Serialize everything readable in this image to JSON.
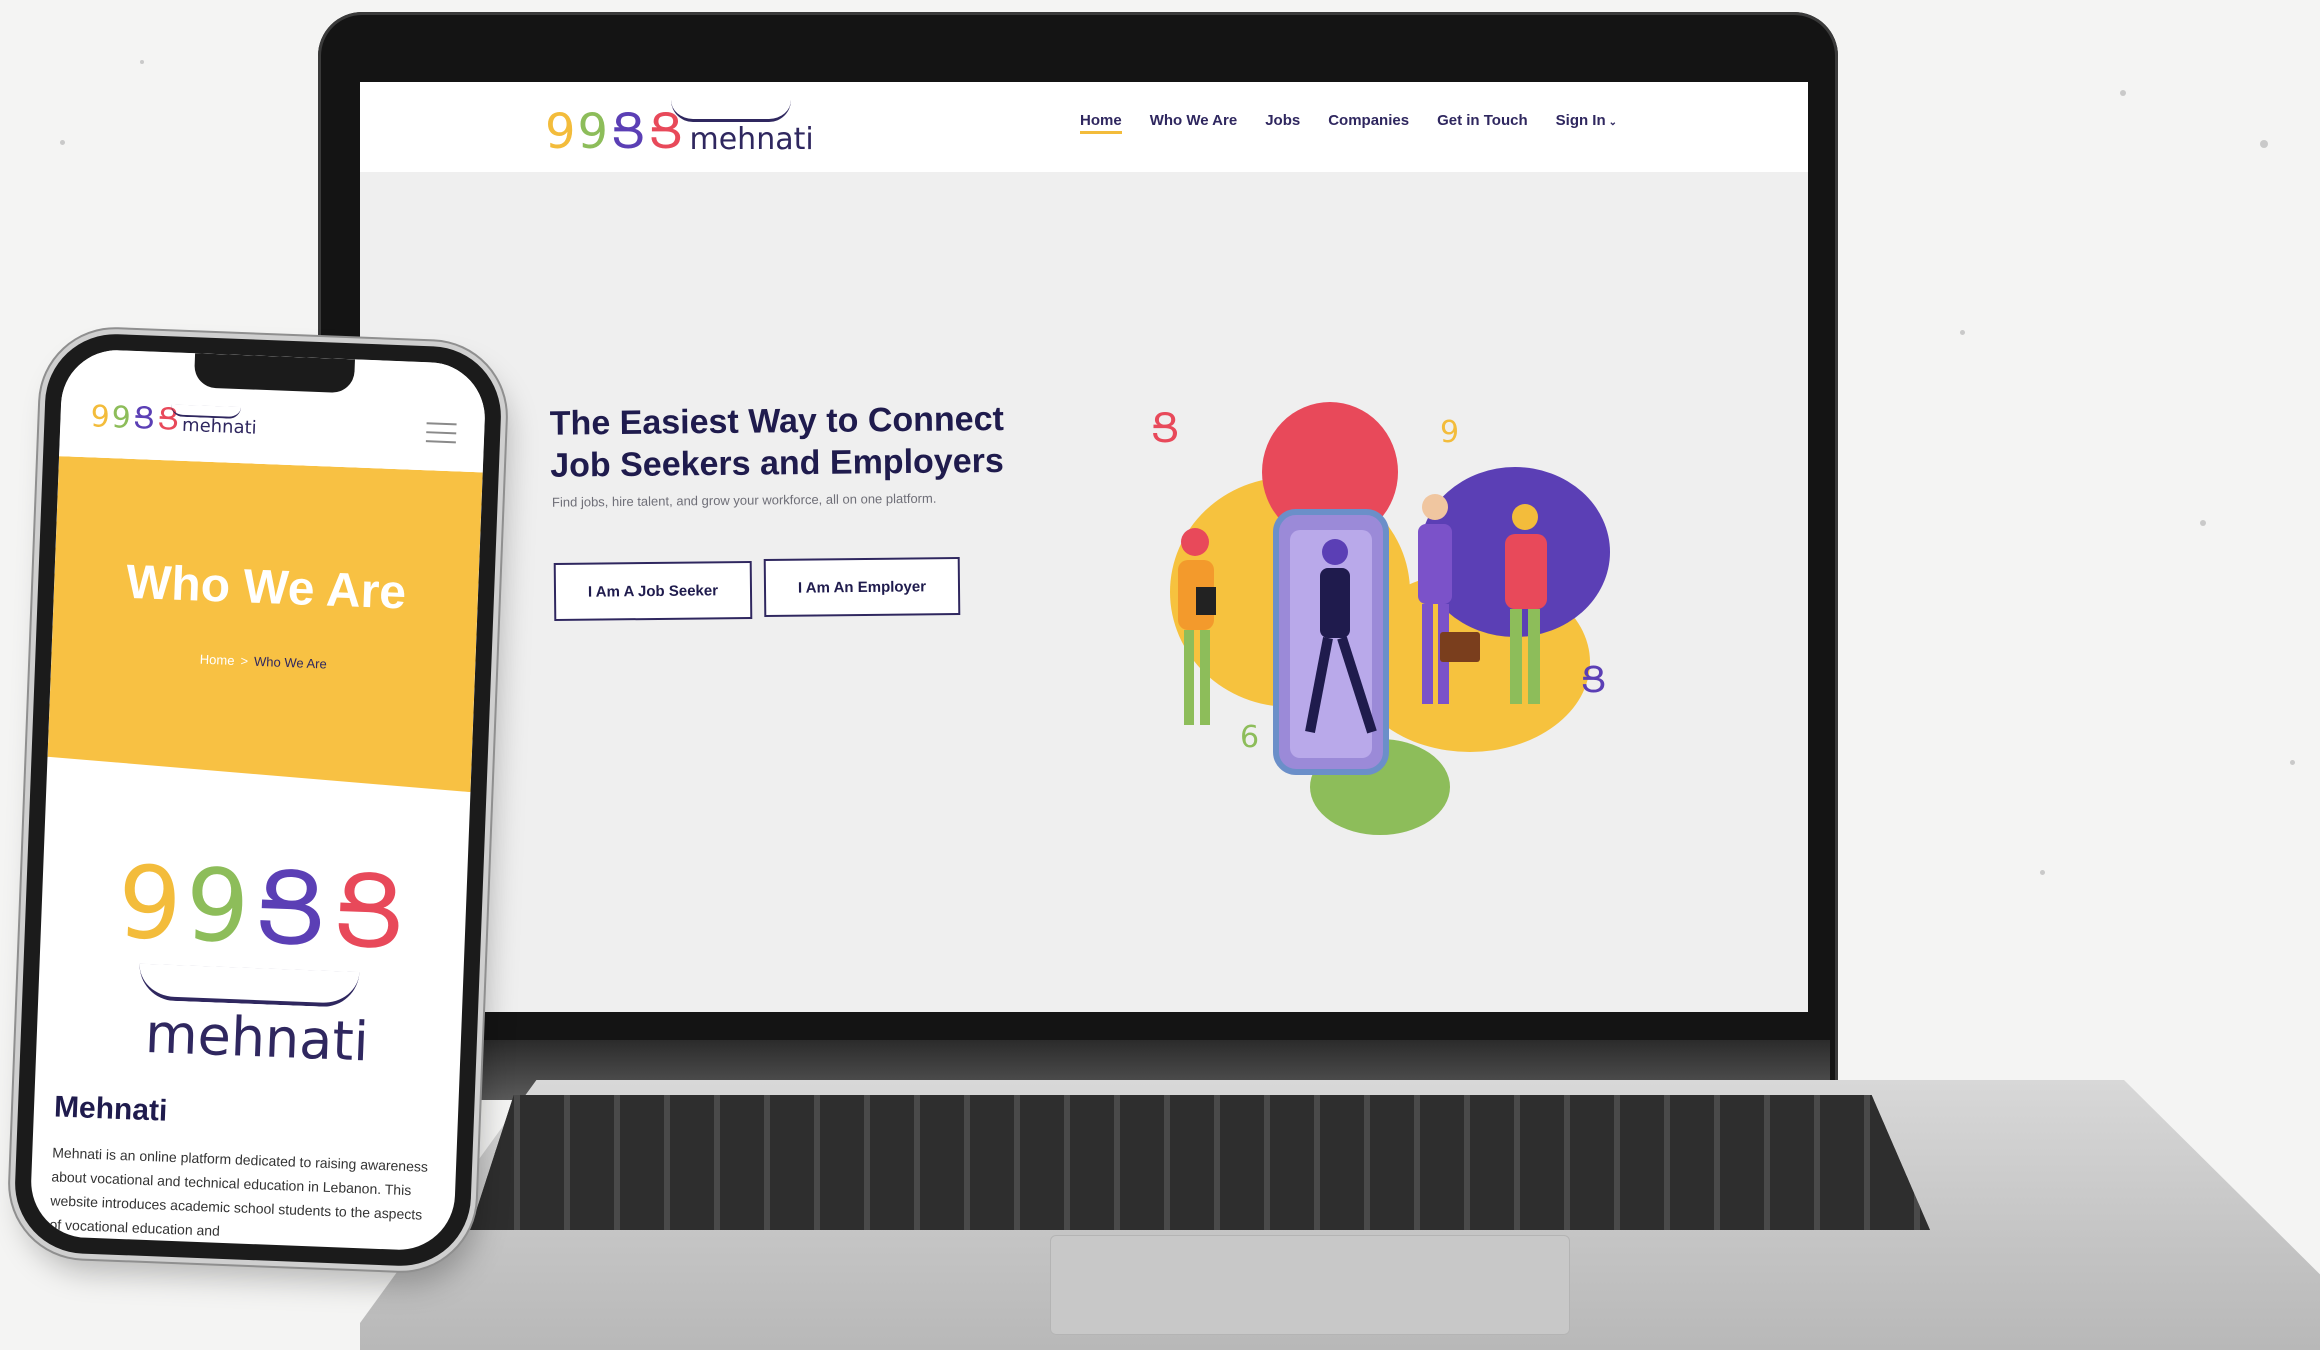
{
  "desktop": {
    "logo": {
      "glyphs": [
        "9",
        "9",
        "Ց",
        "Ց"
      ],
      "wordmark": "mehnati"
    },
    "nav": {
      "home": "Home",
      "who_we_are": "Who We Are",
      "jobs": "Jobs",
      "companies": "Companies",
      "get_in_touch": "Get in Touch",
      "sign_in": "Sign In"
    },
    "hero": {
      "title_line1": "The Easiest Way to Connect",
      "title_line2": "Job Seekers and Employers",
      "subtitle": "Find jobs, hire talent, and grow your workforce, all on one platform.",
      "btn_seeker": "I Am A Job Seeker",
      "btn_employer": "I Am An Employer"
    }
  },
  "mobile": {
    "logo": {
      "glyphs": [
        "9",
        "9",
        "Ց",
        "Ց"
      ],
      "wordmark": "mehnati"
    },
    "hero": {
      "title": "Who We Are",
      "crumb_home": "Home",
      "crumb_sep": ">",
      "crumb_current": "Who We Are"
    },
    "big_logo": {
      "glyphs": [
        "9",
        "9",
        "Ց",
        "Ց"
      ],
      "wordmark": "mehnati"
    },
    "about": {
      "title": "Mehnati",
      "text": "Mehnati is an online platform dedicated to raising awareness about vocational and technical education in Lebanon. This website introduces academic school students to the aspects of vocational education and"
    }
  },
  "colors": {
    "brand_navy": "#2f275f",
    "brand_yellow": "#f8c143",
    "brand_green": "#8dbd5a",
    "brand_purple": "#5b3fb5",
    "brand_red": "#e8495a"
  }
}
